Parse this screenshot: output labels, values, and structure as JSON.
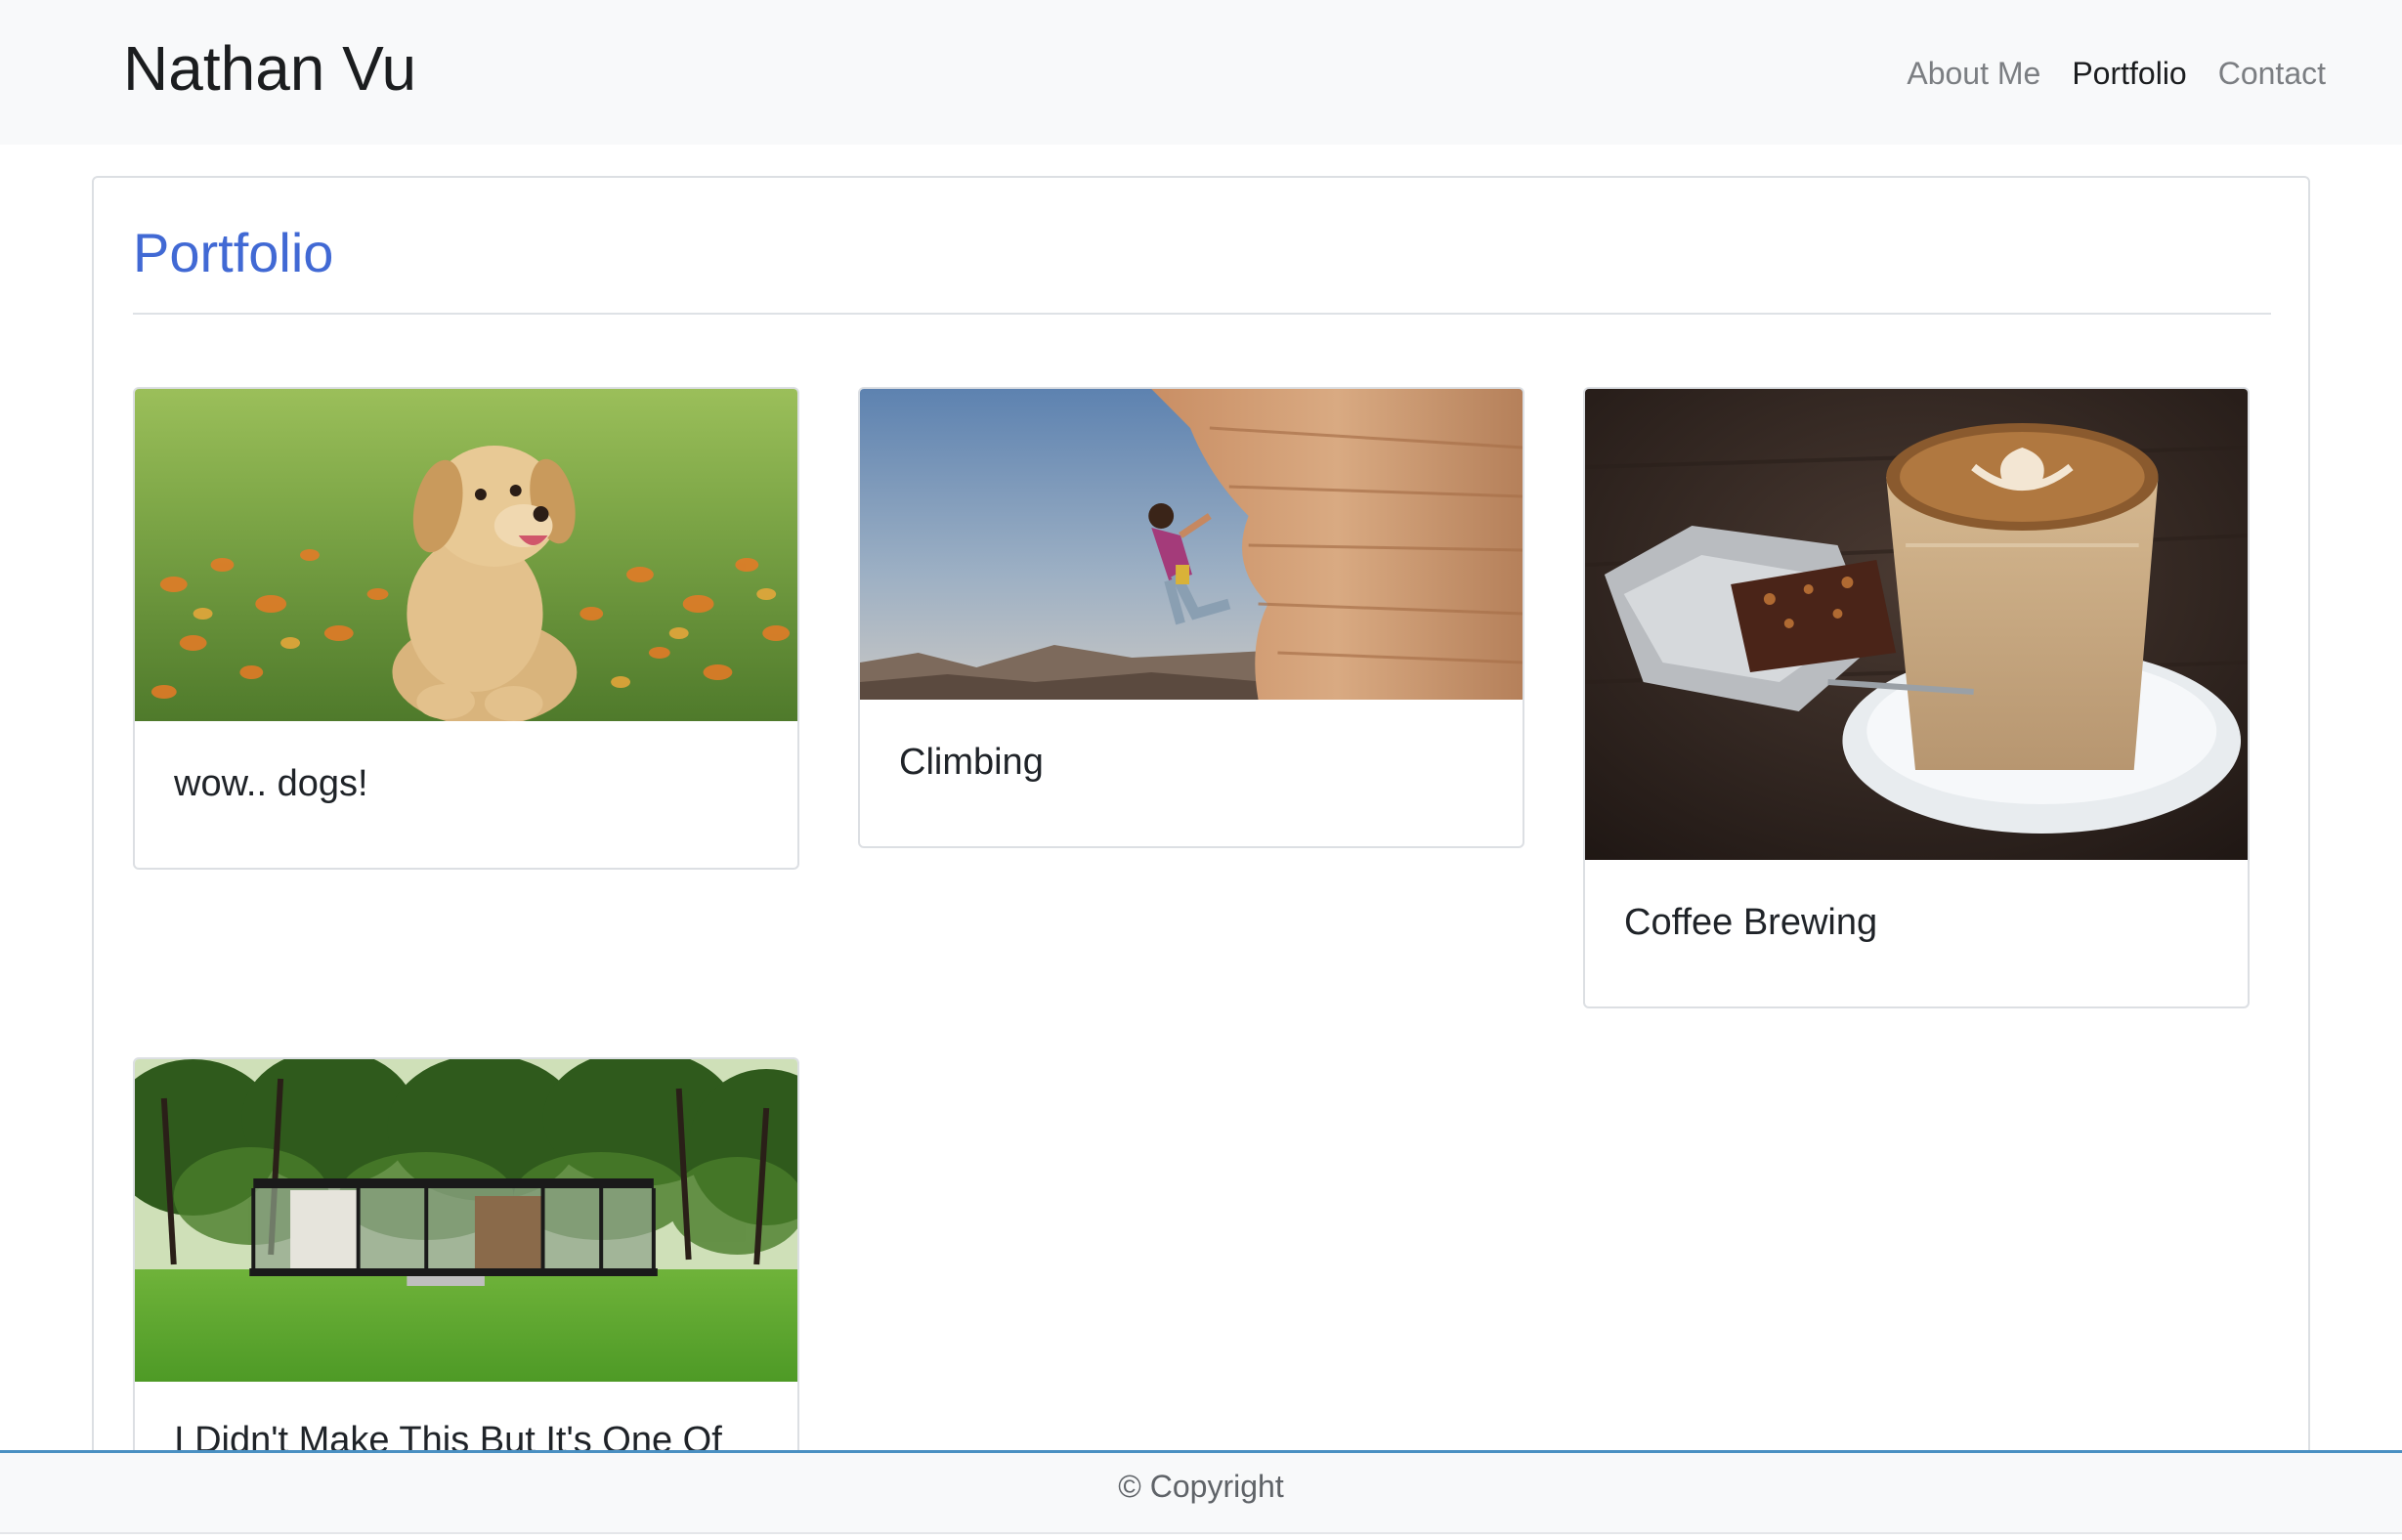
{
  "navbar": {
    "brand": "Nathan Vu",
    "links": [
      {
        "label": "About Me",
        "active": false
      },
      {
        "label": "Portfolio",
        "active": true
      },
      {
        "label": "Contact",
        "active": false
      }
    ]
  },
  "main": {
    "title": "Portfolio",
    "cards": [
      {
        "label": "wow.. dogs!",
        "image": "puppy-in-flower-field"
      },
      {
        "label": "Climbing",
        "image": "rock-climber-on-cliff"
      },
      {
        "label": "Coffee Brewing",
        "image": "latte-and-brownie"
      },
      {
        "label": "I Didn't Make This But It's One Of",
        "image": "glass-house-on-lawn"
      }
    ]
  },
  "footer": {
    "text": "© Copyright"
  },
  "colors": {
    "accent": "#4169d4",
    "navbar_bg": "#f8f9fa",
    "footer_border": "#4a90c2"
  }
}
